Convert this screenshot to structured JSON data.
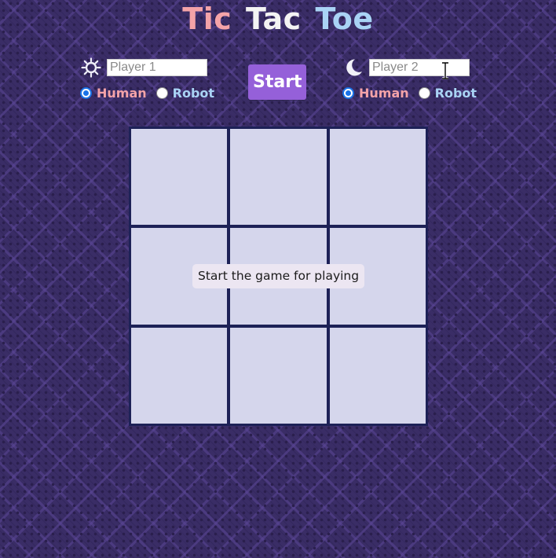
{
  "title": {
    "words": [
      "Tic",
      "Tac",
      "Toe"
    ],
    "colors": [
      "#f4a3a8",
      "#f3f3f3",
      "#a9d3f5"
    ]
  },
  "player1": {
    "icon": "sun-icon",
    "placeholder": "Player 1",
    "value": "",
    "options": [
      {
        "label": "Human",
        "checked": true,
        "color": "#f4a3a8"
      },
      {
        "label": "Robot",
        "checked": false,
        "color": "#a9d3f5"
      }
    ]
  },
  "player2": {
    "icon": "moon-icon",
    "placeholder": "Player 2",
    "value": "",
    "options": [
      {
        "label": "Human",
        "checked": true,
        "color": "#f4a3a8"
      },
      {
        "label": "Robot",
        "checked": false,
        "color": "#a9d3f5"
      }
    ]
  },
  "start_button": {
    "label": "Start",
    "color": "#9560d9"
  },
  "board": {
    "cells": [
      "",
      "",
      "",
      "",
      "",
      "",
      "",
      "",
      ""
    ],
    "cell_color": "#d5d6ec",
    "line_color": "#1d2157"
  },
  "message": "Start the game for playing"
}
